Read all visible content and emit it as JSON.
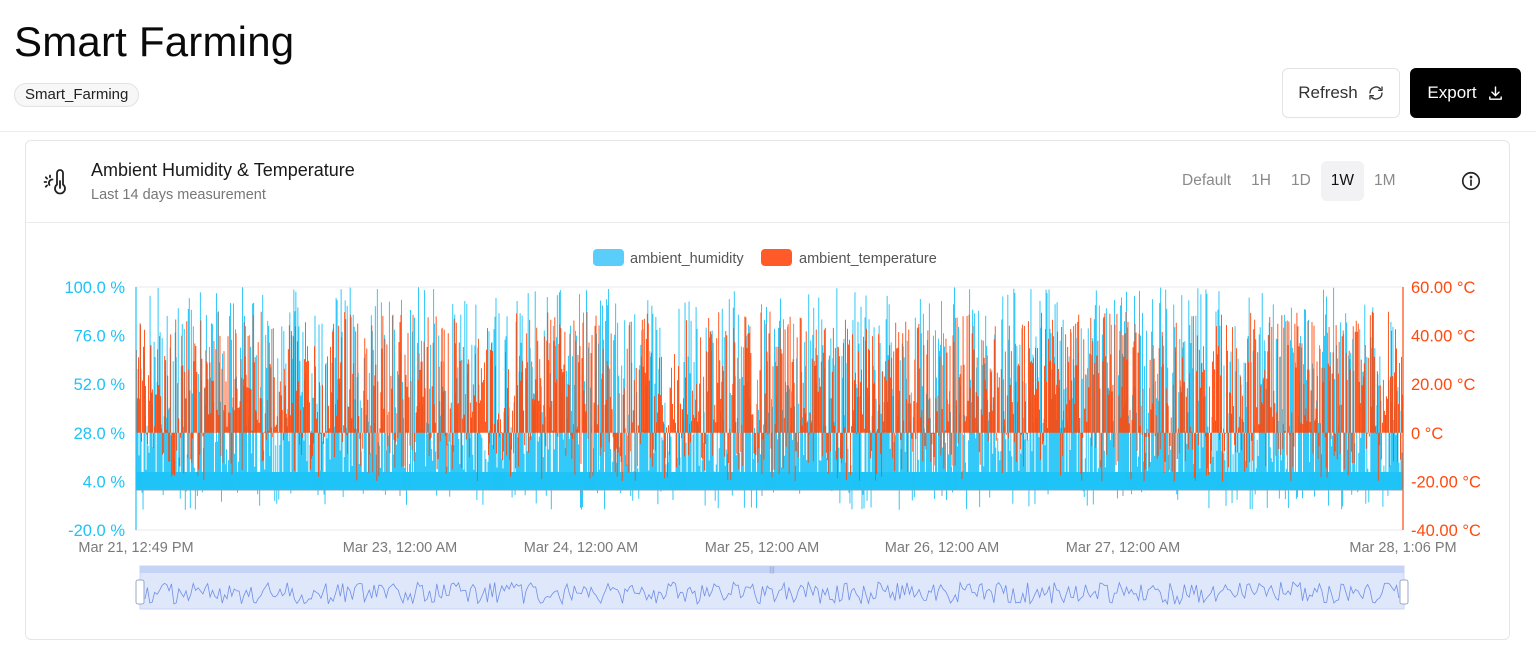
{
  "page": {
    "title": "Smart Farming",
    "tag": "Smart_Farming"
  },
  "toolbar": {
    "refresh_label": "Refresh",
    "export_label": "Export"
  },
  "card": {
    "title": "Ambient Humidity & Temperature",
    "subtitle": "Last 14 days measurement",
    "icon": "thermometer-sun-icon",
    "ranges": [
      {
        "label": "Default",
        "active": false
      },
      {
        "label": "1H",
        "active": false
      },
      {
        "label": "1D",
        "active": false
      },
      {
        "label": "1W",
        "active": true
      },
      {
        "label": "1M",
        "active": false
      }
    ]
  },
  "colors": {
    "humidity": "#1ec3f7",
    "humidity_legend": "#5bcdfa",
    "temperature": "#ff4a0d",
    "temperature_legend": "#ff5a28",
    "slider": "#6f8fe8"
  },
  "chart_data": {
    "type": "bar",
    "series": [
      {
        "name": "ambient_humidity",
        "axis": "left",
        "baseline": -20,
        "typical_range": [
          -20,
          100
        ]
      },
      {
        "name": "ambient_temperature",
        "axis": "right",
        "baseline": 0,
        "typical_range": [
          -20,
          50
        ]
      }
    ],
    "y_left": {
      "unit": "%",
      "min": -20,
      "max": 100,
      "ticks": [
        "100.0 %",
        "76.0 %",
        "52.0 %",
        "28.0 %",
        "4.0 %",
        "-20.0 %"
      ]
    },
    "y_right": {
      "unit": "°C",
      "min": -40,
      "max": 60,
      "ticks": [
        "60.00 °C",
        "40.00 °C",
        "20.00 °C",
        "0 °C",
        "-20.00 °C",
        "-40.00 °C"
      ]
    },
    "x_ticks": [
      "Mar 21, 12:49 PM",
      "Mar 23, 12:00 AM",
      "Mar 24, 12:00 AM",
      "Mar 25, 12:00 AM",
      "Mar 26, 12:00 AM",
      "Mar 27, 12:00 AM",
      "Mar 28, 1:06 PM"
    ],
    "x_range": [
      "Mar 21, 12:49 PM",
      "Mar 28, 1:06 PM"
    ],
    "legend": "top-center",
    "grid": false,
    "data_zoom": {
      "start": 0,
      "end": 1
    }
  }
}
